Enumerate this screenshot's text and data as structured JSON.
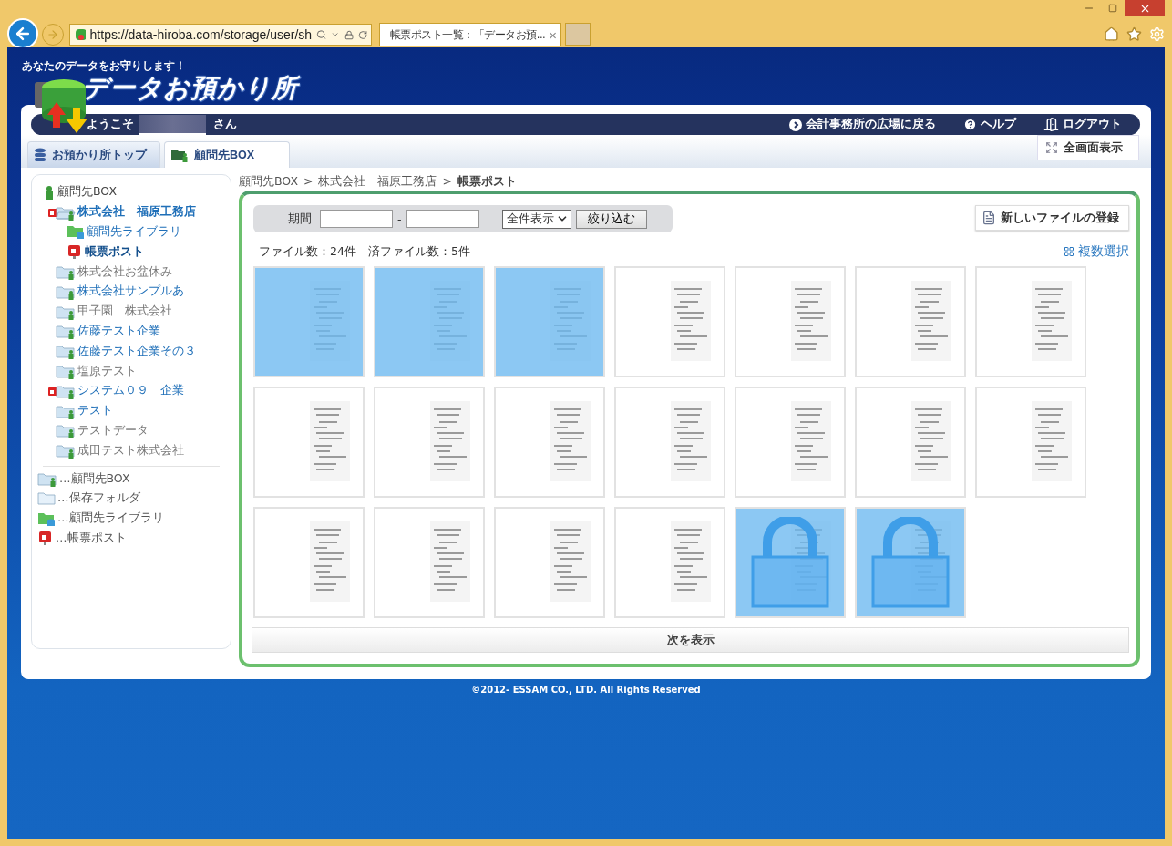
{
  "browser": {
    "address": "https://data-hiroba.com/storage/user/sh",
    "tab_title": "帳票ポスト一覧：「データお預...",
    "tab_close": "×"
  },
  "header": {
    "tagline": "あなたのデータをお守りします！",
    "title": "データお預かり所"
  },
  "navbar": {
    "welcome": "ようこそ",
    "suffix": "さん",
    "links": [
      {
        "label": "会計事務所の広場に戻る",
        "kind": "back"
      },
      {
        "label": "ヘルプ",
        "kind": "help"
      },
      {
        "label": "ログアウト",
        "kind": "logout"
      }
    ]
  },
  "tabs": [
    {
      "label": "お預かり所トップ",
      "kind": "top",
      "selected": false
    },
    {
      "label": "顧問先BOX",
      "kind": "box",
      "selected": true
    }
  ],
  "fullscreen_button": "全画面表示",
  "sidebar": {
    "root": "顧問先BOX",
    "tree": [
      {
        "label": "株式会社　福原工務店",
        "kind": "company",
        "registered": true,
        "has_post": true,
        "expanded": true,
        "selected": false,
        "children": [
          {
            "label": "顧問先ライブラリ",
            "kind": "library",
            "registered": true,
            "selected": false
          },
          {
            "label": "帳票ポスト",
            "kind": "post",
            "registered": true,
            "selected": true
          }
        ]
      },
      {
        "label": "株式会社お盆休み",
        "kind": "company",
        "registered": false,
        "has_post": false,
        "expanded": false,
        "selected": false
      },
      {
        "label": "株式会社サンプルあ",
        "kind": "company",
        "registered": true,
        "has_post": false,
        "expanded": false,
        "selected": false
      },
      {
        "label": "甲子園　株式会社",
        "kind": "company",
        "registered": false,
        "has_post": false,
        "expanded": false,
        "selected": false
      },
      {
        "label": "佐藤テスト企業",
        "kind": "company",
        "registered": true,
        "has_post": false,
        "expanded": false,
        "selected": false
      },
      {
        "label": "佐藤テスト企業その３",
        "kind": "company",
        "registered": true,
        "has_post": false,
        "expanded": false,
        "selected": false
      },
      {
        "label": "塩原テスト",
        "kind": "company",
        "registered": false,
        "has_post": false,
        "expanded": false,
        "selected": false
      },
      {
        "label": "システム０９　企業",
        "kind": "company",
        "registered": true,
        "has_post": true,
        "expanded": false,
        "selected": false
      },
      {
        "label": "テスト",
        "kind": "company",
        "registered": true,
        "has_post": false,
        "expanded": false,
        "selected": false
      },
      {
        "label": "テストデータ",
        "kind": "company",
        "registered": false,
        "has_post": false,
        "expanded": false,
        "selected": false
      },
      {
        "label": "成田テスト株式会社",
        "kind": "company",
        "registered": false,
        "has_post": false,
        "expanded": false,
        "selected": false
      }
    ],
    "legend": [
      {
        "kind": "company",
        "label": "…顧問先BOX"
      },
      {
        "kind": "folder",
        "label": "…保存フォルダ"
      },
      {
        "kind": "library",
        "label": "…顧問先ライブラリ"
      },
      {
        "kind": "post",
        "label": "…帳票ポスト"
      }
    ]
  },
  "breadcrumb": {
    "separator": ">",
    "items": [
      {
        "label": "顧問先BOX",
        "current": false
      },
      {
        "label": "株式会社　福原工務店",
        "current": false
      },
      {
        "label": "帳票ポスト",
        "current": true
      }
    ]
  },
  "filter": {
    "label": "期間",
    "dash": "-",
    "select": "全件表示",
    "button": "絞り込む"
  },
  "new_file_button": "新しいファイルの登録",
  "counts": "ファイル数：24件　済ファイル数：5件",
  "multi_select": "複数選択",
  "files": [
    {
      "selected": true,
      "locked": false
    },
    {
      "selected": true,
      "locked": false
    },
    {
      "selected": true,
      "locked": false
    },
    {
      "selected": false,
      "locked": false
    },
    {
      "selected": false,
      "locked": false
    },
    {
      "selected": false,
      "locked": false
    },
    {
      "selected": false,
      "locked": false
    },
    {
      "selected": false,
      "locked": false
    },
    {
      "selected": false,
      "locked": false
    },
    {
      "selected": false,
      "locked": false
    },
    {
      "selected": false,
      "locked": false
    },
    {
      "selected": false,
      "locked": false
    },
    {
      "selected": false,
      "locked": false
    },
    {
      "selected": false,
      "locked": false
    },
    {
      "selected": false,
      "locked": false
    },
    {
      "selected": false,
      "locked": false
    },
    {
      "selected": false,
      "locked": false
    },
    {
      "selected": false,
      "locked": false
    },
    {
      "selected": true,
      "locked": true
    },
    {
      "selected": true,
      "locked": true
    }
  ],
  "more_button": "次を表示",
  "footer": "©2012- ESSAM CO., LTD. All Rights Reserved"
}
